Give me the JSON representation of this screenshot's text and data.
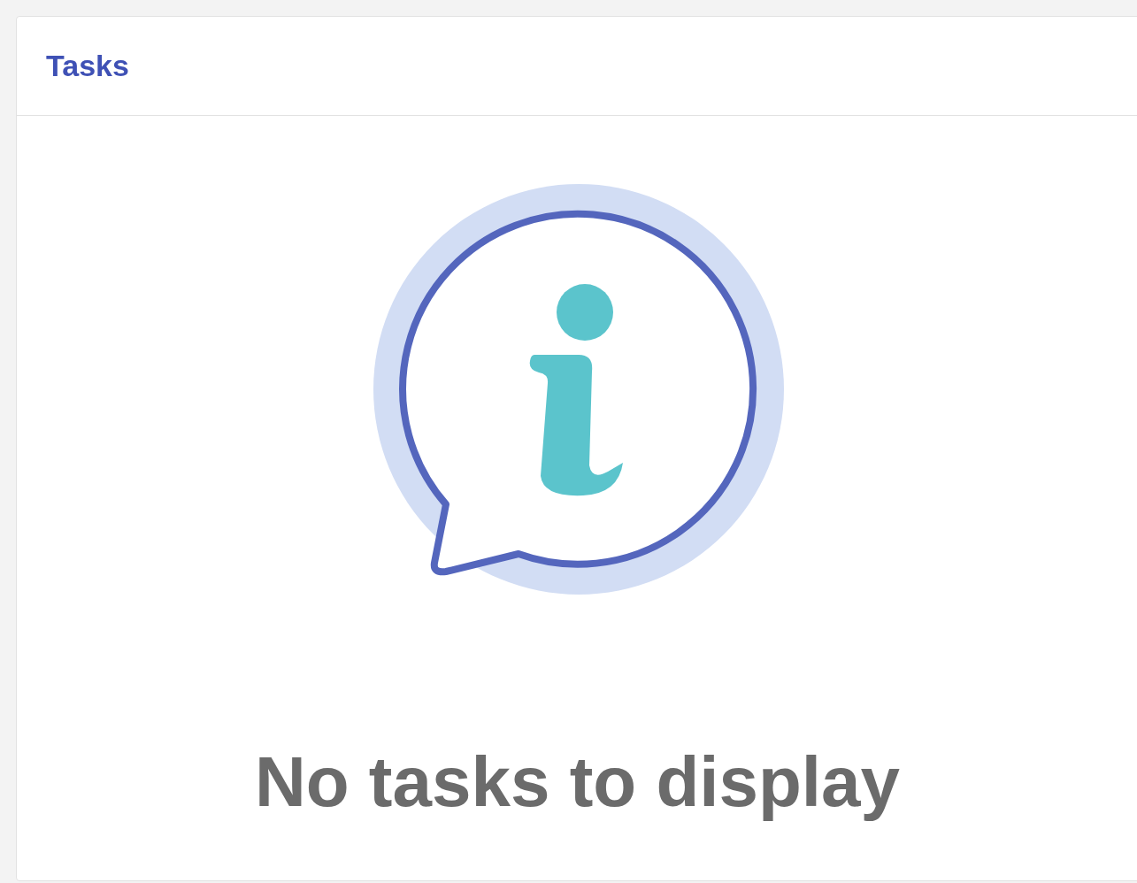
{
  "card": {
    "title": "Tasks"
  },
  "empty_state": {
    "message": "No tasks to display"
  }
}
